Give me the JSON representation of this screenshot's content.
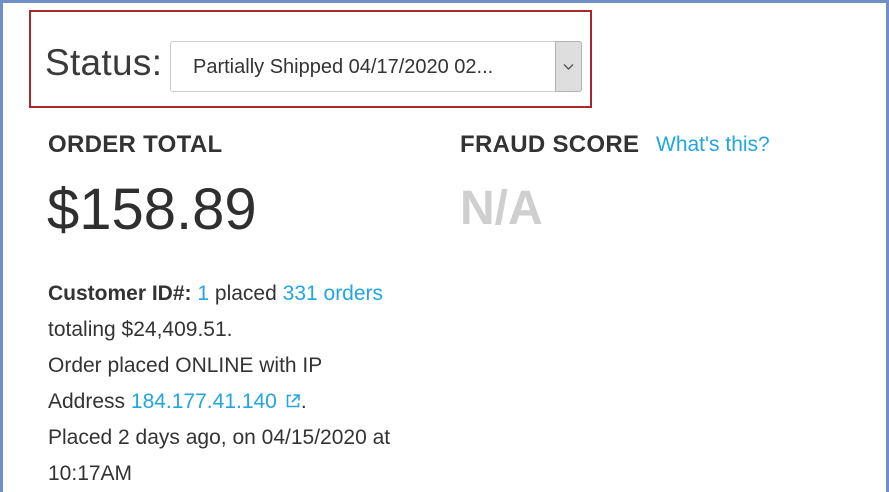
{
  "status": {
    "label": "Status:",
    "selected": "Partially Shipped 04/17/2020 02..."
  },
  "order_total": {
    "heading": "ORDER TOTAL",
    "amount": "$158.89"
  },
  "fraud": {
    "heading": "FRAUD SCORE",
    "help_link": "What's this?",
    "score": "N/A"
  },
  "customer": {
    "id_label": "Customer ID#:",
    "id": "1",
    "placed_word": "placed",
    "orders_link": "331 orders",
    "totaling_text": "totaling $24,409.51.",
    "order_placed_text": "Order placed ONLINE with IP",
    "address_word": "Address",
    "ip_address": "184.177.41.140",
    "period": ".",
    "placed_when": "Placed 2 days ago, on 04/15/2020 at",
    "placed_time": "10:17AM"
  },
  "colors": {
    "accent_link": "#22a6e0",
    "highlight_border": "#a8262e",
    "frame_border": "#6f8fc6",
    "muted_score": "#cfcfcf"
  },
  "icons": {
    "dropdown": "chevron-down-icon",
    "external": "external-link-icon"
  }
}
